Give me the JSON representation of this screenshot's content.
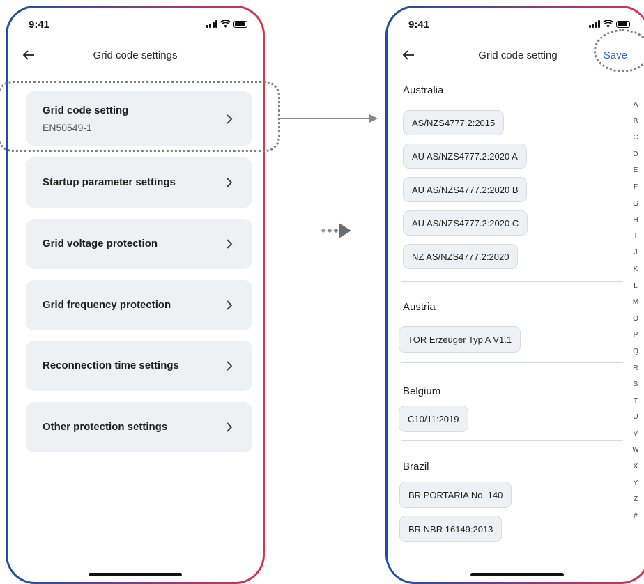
{
  "left_screen": {
    "status_time": "9:41",
    "title": "Grid code settings",
    "items": [
      {
        "label": "Grid code setting",
        "sub": "EN50549-1"
      },
      {
        "label": "Startup parameter settings"
      },
      {
        "label": "Grid voltage protection"
      },
      {
        "label": "Grid frequency protection"
      },
      {
        "label": "Reconnection time settings"
      },
      {
        "label": "Other protection settings"
      }
    ]
  },
  "right_screen": {
    "status_time": "9:41",
    "title": "Grid code setting",
    "save_label": "Save",
    "sections": [
      {
        "name": "Australia",
        "codes": [
          "AS/NZS4777.2:2015",
          "AU AS/NZS4777.2:2020 A",
          "AU AS/NZS4777.2:2020 B",
          "AU AS/NZS4777.2:2020 C",
          "NZ AS/NZS4777.2:2020"
        ]
      },
      {
        "name": "Austria",
        "codes": [
          "TOR Erzeuger Typ A V1.1"
        ]
      },
      {
        "name": "Belgium",
        "codes": [
          "C10/11:2019"
        ]
      },
      {
        "name": "Brazil",
        "codes": [
          "BR PORTARIA No. 140",
          "BR NBR 16149:2013"
        ]
      }
    ],
    "alphabet": [
      "A",
      "B",
      "C",
      "D",
      "E",
      "F",
      "G",
      "H",
      "I",
      "J",
      "K",
      "L",
      "M",
      "O",
      "P",
      "Q",
      "R",
      "S",
      "T",
      "U",
      "V",
      "W",
      "X",
      "Y",
      "Z",
      "#"
    ]
  },
  "colors": {
    "accent": "#3164c8",
    "card_bg": "#eef0f3",
    "frame_start": "#1d4fa6",
    "frame_end": "#d9364d"
  },
  "icons": [
    "back-arrow-icon",
    "chevron-right-icon",
    "signal-icon",
    "wifi-icon",
    "battery-icon",
    "flow-arrow-icon"
  ]
}
